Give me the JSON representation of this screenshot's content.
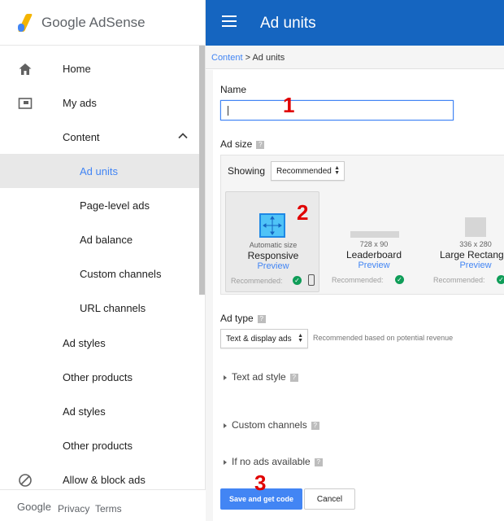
{
  "brand": {
    "google": "Google",
    "product": "AdSense"
  },
  "header": {
    "title": "Ad units"
  },
  "breadcrumb": {
    "parent": "Content",
    "separator": " > ",
    "current": "Ad units"
  },
  "sidebar": {
    "items": [
      {
        "label": "Home",
        "icon": "home-icon"
      },
      {
        "label": "My ads",
        "icon": "my-ads-icon"
      },
      {
        "label": "Content",
        "icon": "chevron-up-icon"
      },
      {
        "label": "Ad units",
        "active": true
      },
      {
        "label": "Page-level ads"
      },
      {
        "label": "Ad balance"
      },
      {
        "label": "Custom channels"
      },
      {
        "label": "URL channels"
      },
      {
        "label": "Ad styles"
      },
      {
        "label": "Other products"
      },
      {
        "label": "Ad styles"
      },
      {
        "label": "Other products"
      },
      {
        "label": "Allow & block ads",
        "icon": "block-icon"
      }
    ],
    "footer": {
      "google": "Google",
      "privacy": "Privacy",
      "terms": "Terms"
    }
  },
  "form": {
    "name_label": "Name",
    "name_value": "",
    "ad_size_label": "Ad size",
    "showing_label": "Showing",
    "showing_value": "Recommended",
    "sizes": [
      {
        "small": "Automatic size",
        "name": "Responsive",
        "preview": "Preview",
        "rec": "Recommended:",
        "selected": true
      },
      {
        "small": "728 x 90",
        "name": "Leaderboard",
        "preview": "Preview",
        "rec": "Recommended:"
      },
      {
        "small": "336 x 280",
        "name": "Large Rectangle",
        "preview": "Preview",
        "rec": "Recommended:"
      }
    ],
    "ad_type_label": "Ad type",
    "ad_type_value": "Text & display ads",
    "ad_type_note": "Recommended based on potential revenue",
    "text_ad_style": "Text ad style",
    "custom_channels": "Custom channels",
    "if_no_ads": "If no ads available",
    "help_glyph": "?",
    "save_label": "Save and get code",
    "cancel_label": "Cancel"
  },
  "annotations": {
    "step1": "1",
    "step2": "2",
    "step3": "3"
  },
  "colors": {
    "header": "#1565c0",
    "accent": "#4285f4",
    "check": "#0f9d58",
    "annotation": "#e00000"
  }
}
